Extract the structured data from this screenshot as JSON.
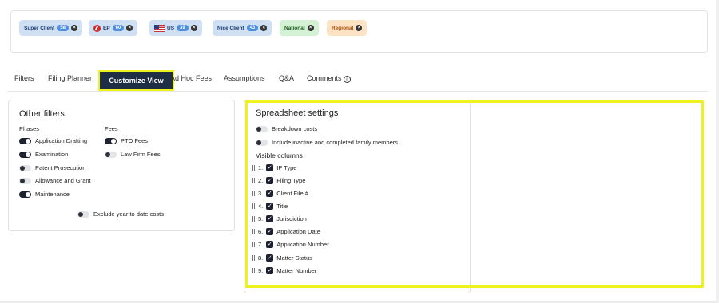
{
  "filter_chips": [
    {
      "label": "Super Client",
      "count": "58",
      "color": "blue"
    },
    {
      "label": "EP",
      "count": "60",
      "color": "blue",
      "flag": "ep-flag-icon"
    },
    {
      "label": "US",
      "count": "39",
      "color": "blue",
      "flag": "us-flag-icon"
    },
    {
      "label": "Nice Client",
      "count": "43",
      "color": "blue"
    },
    {
      "label": "National",
      "color": "green"
    },
    {
      "label": "Regional",
      "color": "orange"
    }
  ],
  "tabs": [
    {
      "label": "Filters"
    },
    {
      "label": "Filing Planner"
    },
    {
      "label": "Customize View",
      "active": true
    },
    {
      "label": "Ad Hoc Fees"
    },
    {
      "label": "Assumptions"
    },
    {
      "label": "Q&A"
    },
    {
      "label": "Comments",
      "icon": "info-icon"
    }
  ],
  "other_filters": {
    "title": "Other filters",
    "phases_heading": "Phases",
    "fees_heading": "Fees",
    "phases": [
      {
        "label": "Application Drafting",
        "on": true
      },
      {
        "label": "Examination",
        "on": true
      },
      {
        "label": "Patent Prosecution",
        "on": false
      },
      {
        "label": "Allowance and Grant",
        "on": false
      },
      {
        "label": "Maintenance",
        "on": true
      }
    ],
    "fees": [
      {
        "label": "PTO Fees",
        "on": true
      },
      {
        "label": "Law Firm Fees",
        "on": false
      }
    ],
    "exclude_ytd": {
      "label": "Exclude year to date costs",
      "on": false
    }
  },
  "spreadsheet_settings": {
    "title": "Spreadsheet settings",
    "breakdown": {
      "label": "Breakdown costs",
      "on": false
    },
    "include_inactive": {
      "label": "Include inactive and completed family members",
      "on": false
    },
    "visible_columns_heading": "Visible columns",
    "columns": [
      {
        "num": "1.",
        "label": "IP Type",
        "checked": true
      },
      {
        "num": "2.",
        "label": "Filing Type",
        "checked": true
      },
      {
        "num": "3.",
        "label": "Client File #",
        "checked": true
      },
      {
        "num": "4.",
        "label": "Title",
        "checked": true
      },
      {
        "num": "5.",
        "label": "Jurisdiction",
        "checked": true
      },
      {
        "num": "6.",
        "label": "Application Date",
        "checked": true
      },
      {
        "num": "7.",
        "label": "Application Number",
        "checked": true
      },
      {
        "num": "8.",
        "label": "Matter Status",
        "checked": true
      },
      {
        "num": "9.",
        "label": "Matter Number",
        "checked": true
      }
    ]
  },
  "colors": {
    "highlight": "#f0f21f",
    "active_tab": "#1e2e45",
    "chip_count": "#4d8ee0"
  }
}
